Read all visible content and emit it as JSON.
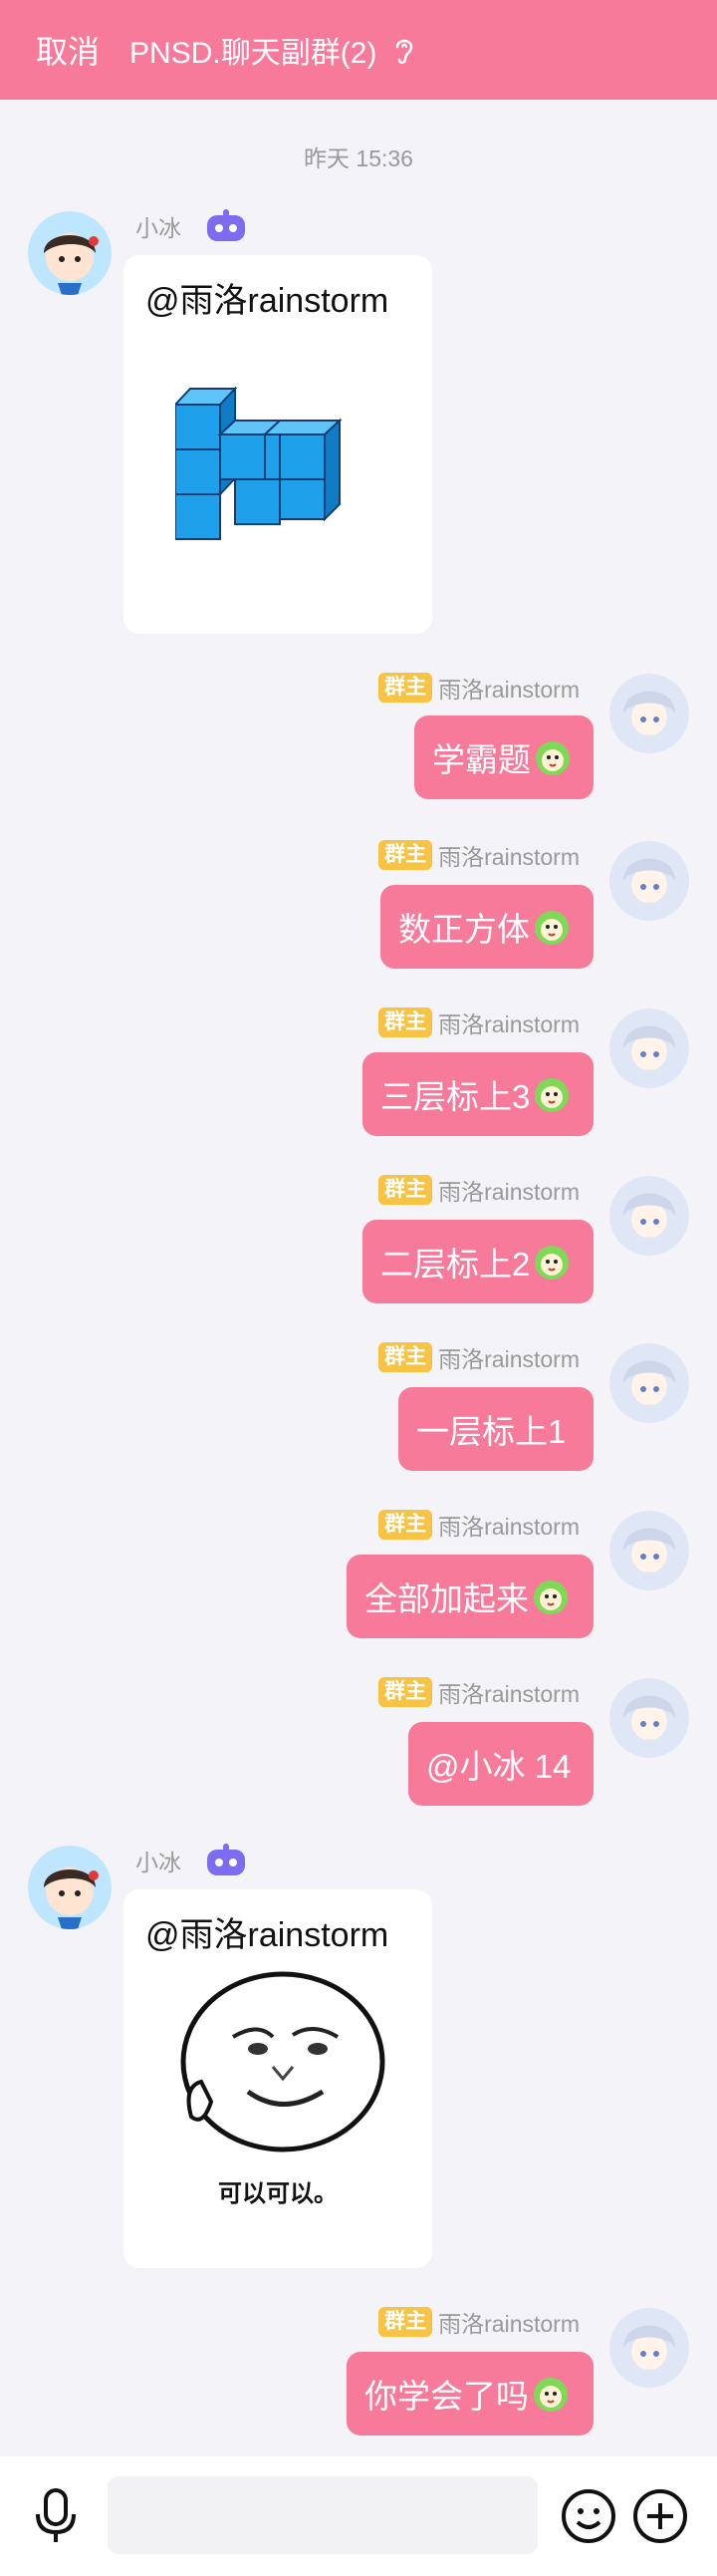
{
  "header": {
    "cancel_label": "取消",
    "title": "PNSD.聊天副群(2)"
  },
  "timestamp": "昨天 15:36",
  "bot": {
    "name": "小冰"
  },
  "owner": {
    "badge": "群主",
    "name": "雨洛rainstorm"
  },
  "messages": [
    {
      "type": "bot_card",
      "mention": "@雨洛rainstorm",
      "image": "cube-stack-figure"
    },
    {
      "type": "owner_text",
      "text": "学霸题",
      "emoji": true
    },
    {
      "type": "owner_text",
      "text": "数正方体",
      "emoji": true
    },
    {
      "type": "owner_text",
      "text": "三层标上3",
      "emoji": true
    },
    {
      "type": "owner_text",
      "text": "二层标上2",
      "emoji": true
    },
    {
      "type": "owner_text",
      "text": "一层标上1",
      "emoji": false
    },
    {
      "type": "owner_text",
      "text": "全部加起来",
      "emoji": true
    },
    {
      "type": "owner_text",
      "text": "@小冰 14",
      "emoji": false
    },
    {
      "type": "bot_card",
      "mention": "@雨洛rainstorm",
      "image": "meme-face-thumbs-up",
      "caption": "可以可以。"
    },
    {
      "type": "owner_text",
      "text": "你学会了吗",
      "emoji": true
    }
  ],
  "colors": {
    "accent": "#f87a9b",
    "badge": "#f6c343",
    "background": "#f4f3f7"
  },
  "icons": [
    "ear-icon",
    "bot-icon",
    "emoji-dog-icon",
    "mic-icon",
    "smile-icon",
    "plus-icon"
  ]
}
